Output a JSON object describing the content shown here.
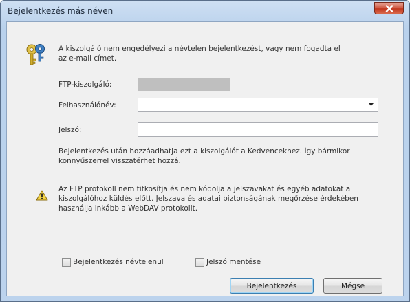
{
  "window": {
    "title": "Bejelentkezés más néven"
  },
  "message": {
    "line1": "A kiszolgáló nem engedélyezi a névtelen bejelentkezést, vagy nem fogadta el",
    "line2": "az e-mail címet."
  },
  "form": {
    "server_label": "FTP-kiszolgáló:",
    "username_label": "Felhasználónév:",
    "username_value": "",
    "password_label": "Jelszó:",
    "password_value": ""
  },
  "info": {
    "line1": "Bejelentkezés után hozzáadhatja ezt a kiszolgálót a Kedvencekhez. Így bármikor",
    "line2": "könnyűszerrel visszatérhet hozzá."
  },
  "warning": {
    "line1": "Az FTP protokoll nem titkosítja és nem kódolja a jelszavakat és egyéb adatokat a",
    "line2": "kiszolgálóhoz küldés előtt. Jelszava és adatai biztonságának megőrzése érdekében",
    "line3": "használja inkább a WebDAV protokollt."
  },
  "options": {
    "anonymous_label": "Bejelentkezés névtelenül",
    "anonymous_checked": false,
    "save_password_label": "Jelszó mentése",
    "save_password_checked": false
  },
  "buttons": {
    "login": "Bejelentkezés",
    "cancel": "Mégse"
  },
  "colors": {
    "titlebar": "#b9d1ec",
    "client_bg": "#f0f0f0",
    "close_button": "#c2381f"
  },
  "icons": {
    "header": "keys-icon",
    "warning": "warning-icon",
    "close": "close-icon",
    "dropdown": "chevron-down-icon"
  }
}
